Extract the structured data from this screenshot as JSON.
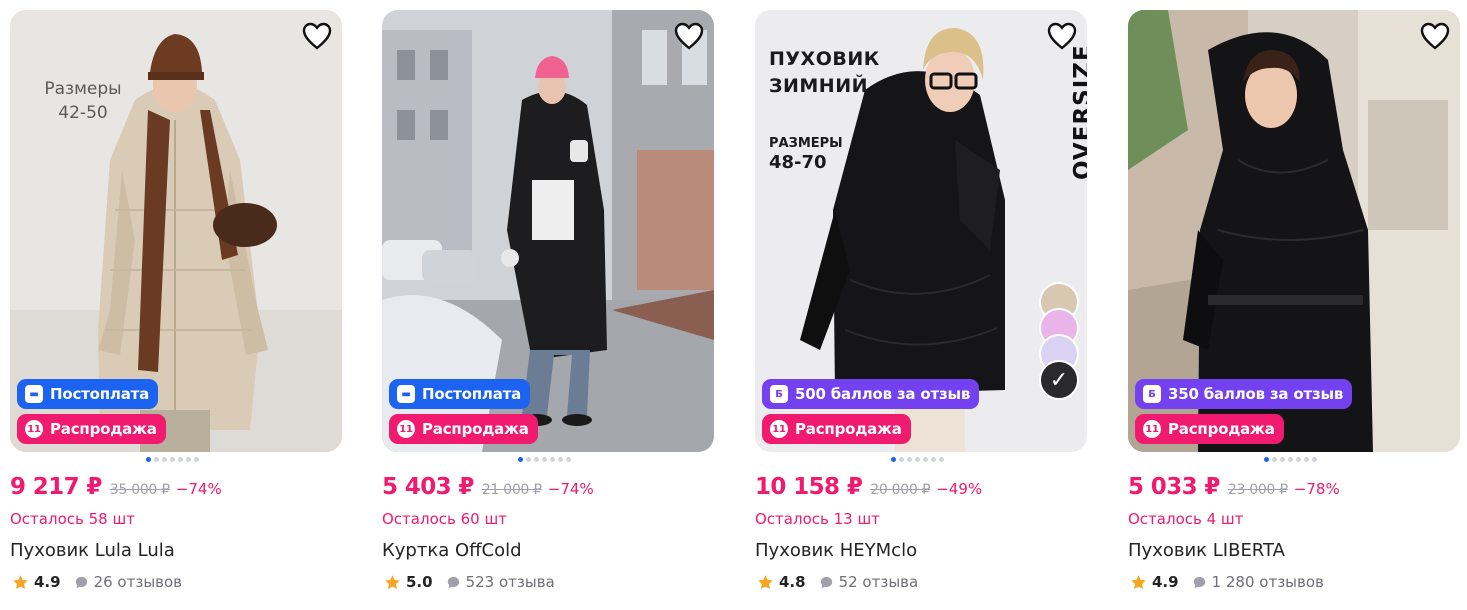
{
  "products": [
    {
      "name": "Пуховик Lula Lula",
      "price": "9 217 ₽",
      "old_price": "35 000 ₽",
      "discount": "−74%",
      "stock": "Осталось 58 шт",
      "rating": "4.9",
      "reviews": "26 отзывов",
      "badges": [
        "Постоплата",
        "Распродажа"
      ],
      "photo_text": [
        "Размеры",
        "42-50"
      ]
    },
    {
      "name": "Куртка OffCold",
      "price": "5 403 ₽",
      "old_price": "21 000 ₽",
      "discount": "−74%",
      "stock": "Осталось 60 шт",
      "rating": "5.0",
      "reviews": "523 отзыва",
      "badges": [
        "Постоплата",
        "Распродажа"
      ]
    },
    {
      "name": "Пуховик HEYMclo",
      "price": "10 158 ₽",
      "old_price": "20 000 ₽",
      "discount": "−49%",
      "stock": "Осталось 13 шт",
      "rating": "4.8",
      "reviews": "52 отзыва",
      "badges": [
        "500 баллов за отзыв",
        "Распродажа"
      ],
      "photo_text": [
        "ПУХОВИК",
        "ЗИМНИЙ",
        "РАЗМЕРЫ",
        "48-70",
        "OVERSIZE"
      ]
    },
    {
      "name": "Пуховик LIBERTA",
      "price": "5 033 ₽",
      "old_price": "23 000 ₽",
      "discount": "−78%",
      "stock": "Осталось 4 шт",
      "rating": "4.9",
      "reviews": "1 280 отзывов",
      "badges": [
        "350 баллов за отзыв",
        "Распродажа"
      ]
    }
  ],
  "icons": {
    "favorite": "heart-outline-icon",
    "postpay": "wallet-icon",
    "sale": "sale-tag-icon",
    "bonus": "bonus-b-icon",
    "rating": "star-icon",
    "reviews": "speech-bubble-icon"
  },
  "colors": {
    "accent_pink": "#f01a6e",
    "postpay_blue": "#1d63f2",
    "bonus_purple": "#7341f0",
    "star": "#f5a623",
    "muted": "#a0a0ab"
  },
  "carousel": {
    "photos": 7,
    "active": 1
  }
}
